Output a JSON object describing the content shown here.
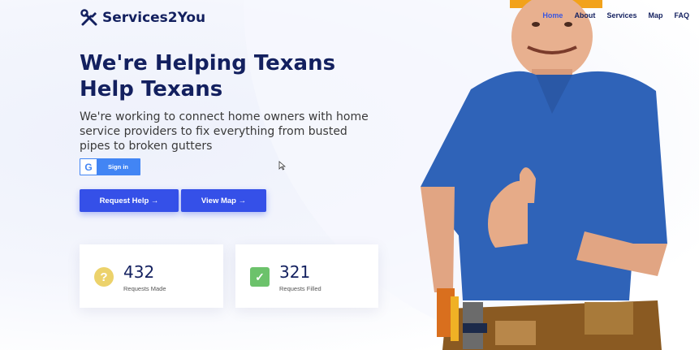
{
  "brand": {
    "name": "Services2You",
    "icon": "tools-icon",
    "primary_color": "#3550e8",
    "navy_color": "#13205f"
  },
  "nav": {
    "items": [
      {
        "label": "Home",
        "active": true
      },
      {
        "label": "About",
        "active": false
      },
      {
        "label": "Services",
        "active": false
      },
      {
        "label": "Map",
        "active": false
      },
      {
        "label": "FAQ",
        "active": false
      }
    ]
  },
  "hero": {
    "title": "We're Helping Texans Help Texans",
    "subtitle": "We're working to connect home owners with home service providers to fix everything from busted pipes to broken gutters"
  },
  "signin": {
    "g_letter": "G",
    "label": "Sign in",
    "icon": "google-icon"
  },
  "buttons": {
    "request_help": "Request Help →",
    "view_map": "View Map →"
  },
  "stats": [
    {
      "value": "432",
      "label": "Requests Made",
      "icon": "question-icon",
      "icon_glyph": "?",
      "color": "#ecd26b"
    },
    {
      "value": "321",
      "label": "Requests Filled",
      "icon": "check-icon",
      "icon_glyph": "✓",
      "color": "#6cc26b"
    }
  ]
}
